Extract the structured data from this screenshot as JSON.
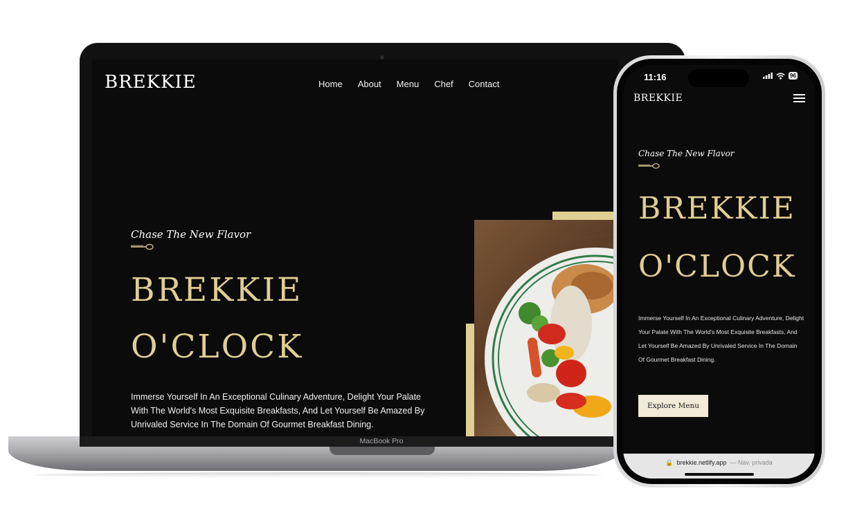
{
  "laptop": {
    "model_label": "MacBook Pro",
    "site": {
      "logo": "BREKKIE",
      "nav": [
        "Home",
        "About",
        "Menu",
        "Chef",
        "Contact"
      ],
      "tagline": "Chase The New Flavor",
      "title_line1": "BREKKIE",
      "title_line2": "O'CLOCK",
      "description": "Immerse Yourself In An Exceptional Culinary Adventure, Delight Your Palate With The World's Most Exquisite Breakfasts, And Let Yourself Be Amazed By Unrivaled Service In The Domain Of Gourmet Breakfast Dining."
    }
  },
  "phone": {
    "status": {
      "time": "11:16",
      "battery": "96"
    },
    "site": {
      "logo": "BREKKIE",
      "tagline": "Chase The New Flavor",
      "title_line1": "BREKKIE",
      "title_line2": "O'CLOCK",
      "description": "Immerse Yourself In An Exceptional Culinary Adventure, Delight Your Palate With The World's Most Exquisite Breakfasts, And Let Yourself Be Amazed By Unrivaled Service In The Domain Of Gourmet Breakfast Dining.",
      "cta_label": "Explore Menu"
    },
    "browser": {
      "url": "brekkie.netlify.app",
      "mode": "— Nav. privada"
    }
  },
  "colors": {
    "accent_gold": "#e1cd93",
    "background": "#0b0b0b",
    "button_bg": "#f2ebd8"
  },
  "icons": [
    "spoon-icon",
    "hamburger-menu-icon",
    "signal-icon",
    "wifi-icon",
    "battery-icon",
    "lock-icon"
  ]
}
